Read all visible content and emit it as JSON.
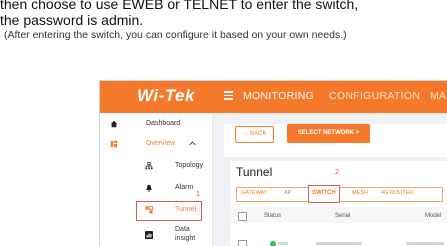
{
  "instructions": {
    "line1": "then choose to use EWEB or TELNET to enter the switch,",
    "line2": "the password is admin.",
    "line3": "(After entering the switch, you can configure it based on your own needs.)"
  },
  "app": {
    "logo": "Wi-Tek",
    "nav": [
      "MONITORING",
      "CONFIGURATION",
      "MA"
    ]
  },
  "sidebar": {
    "items": [
      {
        "label": "Dashboard",
        "icon": "home-icon"
      },
      {
        "label": "Overview",
        "icon": "overview-icon"
      },
      {
        "label": "Topology",
        "icon": "topology-icon"
      },
      {
        "label": "Alarm",
        "icon": "bell-icon"
      },
      {
        "label": "Tunnel",
        "icon": "tunnel-icon"
      },
      {
        "label": "Data",
        "label2": "insight",
        "icon": "chart-icon"
      }
    ]
  },
  "toolbar": {
    "back_label": "← BACK",
    "select_network_label": "SELECT NETWORK  >"
  },
  "panel": {
    "title": "Tunnel",
    "tabs": [
      "GATEWAY",
      "AP",
      "SWITCH",
      "MESH",
      "4G ROUTER"
    ],
    "active_tab": "SWITCH"
  },
  "table": {
    "columns": [
      "Status",
      "Serial",
      "Model"
    ]
  },
  "annotations": {
    "step1": "1",
    "step2": "2"
  },
  "colors": {
    "brand": "#f5792a",
    "highlight": "#e05757",
    "online": "#3cb371"
  }
}
